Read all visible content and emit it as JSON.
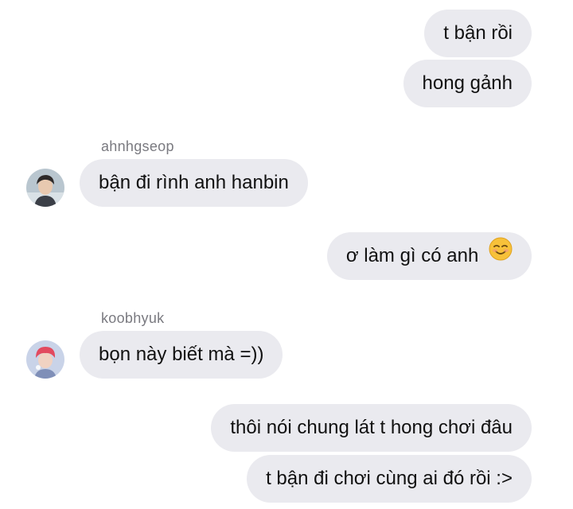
{
  "messages": [
    {
      "sender": "me",
      "text": "t bận rồi"
    },
    {
      "sender": "me",
      "text": "hong gảnh"
    },
    {
      "sender": "ahnhgseop",
      "text": "bận đi rình anh hanbin"
    },
    {
      "sender": "me",
      "text": "ơ làm gì có anh",
      "emoji": "smiling-face-icon"
    },
    {
      "sender": "koobhyuk",
      "text": "bọn này biết mà =))"
    },
    {
      "sender": "me",
      "text": "thôi nói chung lát t hong chơi đâu"
    },
    {
      "sender": "me",
      "text": "t bận đi chơi cùng ai đó rồi :>"
    }
  ],
  "colors": {
    "bubble_bg": "#eaeaef",
    "text": "#111111",
    "sender_name": "#7a7a80",
    "emoji": "#f7c13a"
  }
}
